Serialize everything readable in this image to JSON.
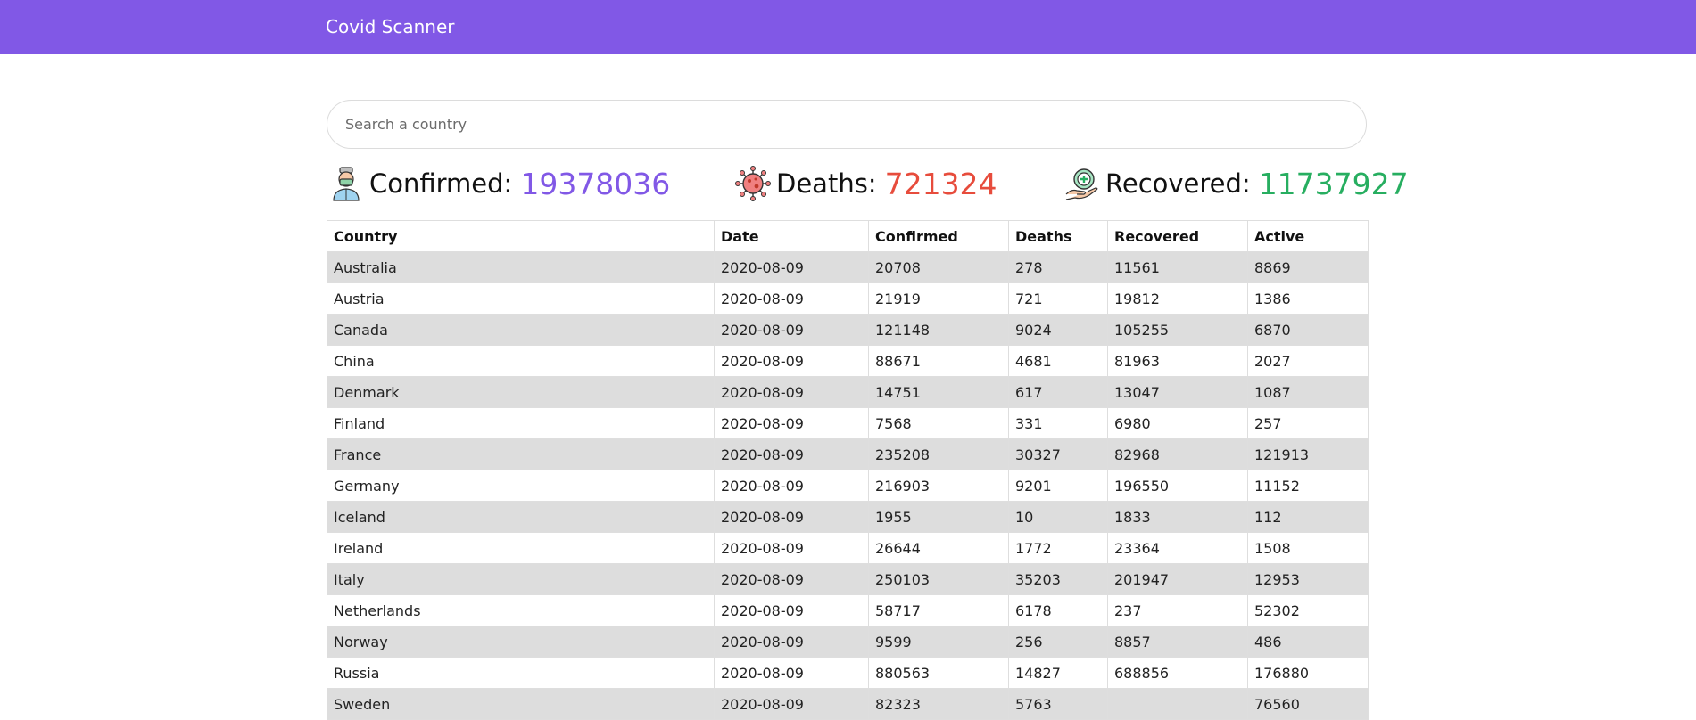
{
  "navbar": {
    "brand": "Covid Scanner",
    "color": "#8158e6"
  },
  "search": {
    "placeholder": "Search a country",
    "value": ""
  },
  "stats": {
    "confirmed": {
      "label": "Confirmed:",
      "value": "19378036",
      "color": "#8158e6",
      "icon": "doctor-mask-icon"
    },
    "deaths": {
      "label": "Deaths:",
      "value": "721324",
      "color": "#e74c3c",
      "icon": "virus-icon"
    },
    "recovered": {
      "label": "Recovered:",
      "value": "11737927",
      "color": "#27ae60",
      "icon": "hand-medical-icon"
    }
  },
  "table": {
    "columns": [
      "Country",
      "Date",
      "Confirmed",
      "Deaths",
      "Recovered",
      "Active"
    ],
    "rows": [
      [
        "Australia",
        "2020-08-09",
        "20708",
        "278",
        "11561",
        "8869"
      ],
      [
        "Austria",
        "2020-08-09",
        "21919",
        "721",
        "19812",
        "1386"
      ],
      [
        "Canada",
        "2020-08-09",
        "121148",
        "9024",
        "105255",
        "6870"
      ],
      [
        "China",
        "2020-08-09",
        "88671",
        "4681",
        "81963",
        "2027"
      ],
      [
        "Denmark",
        "2020-08-09",
        "14751",
        "617",
        "13047",
        "1087"
      ],
      [
        "Finland",
        "2020-08-09",
        "7568",
        "331",
        "6980",
        "257"
      ],
      [
        "France",
        "2020-08-09",
        "235208",
        "30327",
        "82968",
        "121913"
      ],
      [
        "Germany",
        "2020-08-09",
        "216903",
        "9201",
        "196550",
        "11152"
      ],
      [
        "Iceland",
        "2020-08-09",
        "1955",
        "10",
        "1833",
        "112"
      ],
      [
        "Ireland",
        "2020-08-09",
        "26644",
        "1772",
        "23364",
        "1508"
      ],
      [
        "Italy",
        "2020-08-09",
        "250103",
        "35203",
        "201947",
        "12953"
      ],
      [
        "Netherlands",
        "2020-08-09",
        "58717",
        "6178",
        "237",
        "52302"
      ],
      [
        "Norway",
        "2020-08-09",
        "9599",
        "256",
        "8857",
        "486"
      ],
      [
        "Russia",
        "2020-08-09",
        "880563",
        "14827",
        "688856",
        "176880"
      ],
      [
        "Sweden",
        "2020-08-09",
        "82323",
        "5763",
        "",
        "76560"
      ]
    ]
  }
}
